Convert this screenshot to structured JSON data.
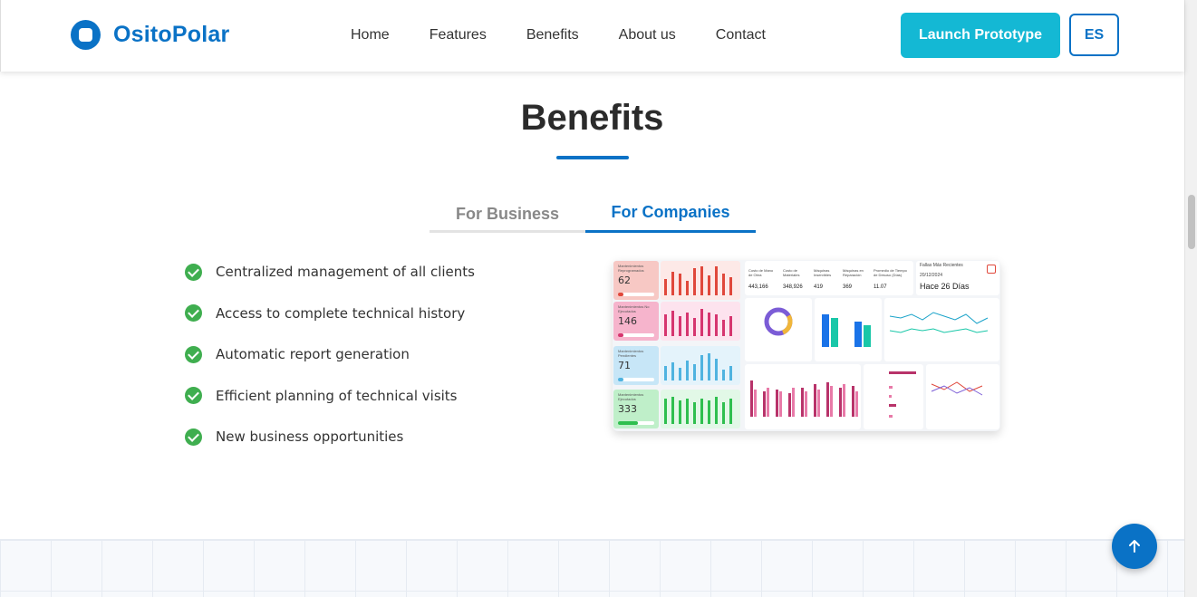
{
  "brand": {
    "name": "OsitoPolar"
  },
  "nav": {
    "items": [
      "Home",
      "Features",
      "Benefits",
      "About us",
      "Contact"
    ]
  },
  "actions": {
    "launch_label": "Launch Prototype",
    "lang_label": "ES"
  },
  "section": {
    "title": "Benefits",
    "tabs": [
      {
        "label": "For Business",
        "active": false
      },
      {
        "label": "For Companies",
        "active": true
      }
    ],
    "benefits": [
      "Centralized management of all clients",
      "Access to complete technical history",
      "Automatic report generation",
      "Efficient planning of technical visits",
      "New business opportunities"
    ]
  },
  "dashboard": {
    "kpis": [
      {
        "label": "Mantenimientos Reprogramados",
        "value": "62"
      },
      {
        "label": "Mantenimientos No Ejecutados",
        "value": "146"
      },
      {
        "label": "Mantenimientos Pendientes",
        "value": "71"
      },
      {
        "label": "Mantenimientos Ejecutados",
        "value": "333"
      }
    ],
    "top_stats": [
      {
        "label": "Costo de Mano de Obra",
        "value": "443,166"
      },
      {
        "label": "Costo de Materiales",
        "value": "348,926"
      },
      {
        "label": "Máquinas Inservibles",
        "value": "419"
      },
      {
        "label": "Máquinas en Reparación",
        "value": "369"
      },
      {
        "label": "Promedio de Tiempo de Desuso (Días)",
        "value": "11.07"
      }
    ],
    "recent": {
      "label": "Fallas Más Recientes",
      "date": "20/12/2024",
      "value": "Hace 26 Días"
    }
  },
  "colors": {
    "primary": "#0a72c6",
    "accent": "#14b8d4",
    "check": "#3fae4f"
  },
  "icons": {
    "back_to_top": "arrow-up-icon",
    "check": "check-circle-icon"
  }
}
